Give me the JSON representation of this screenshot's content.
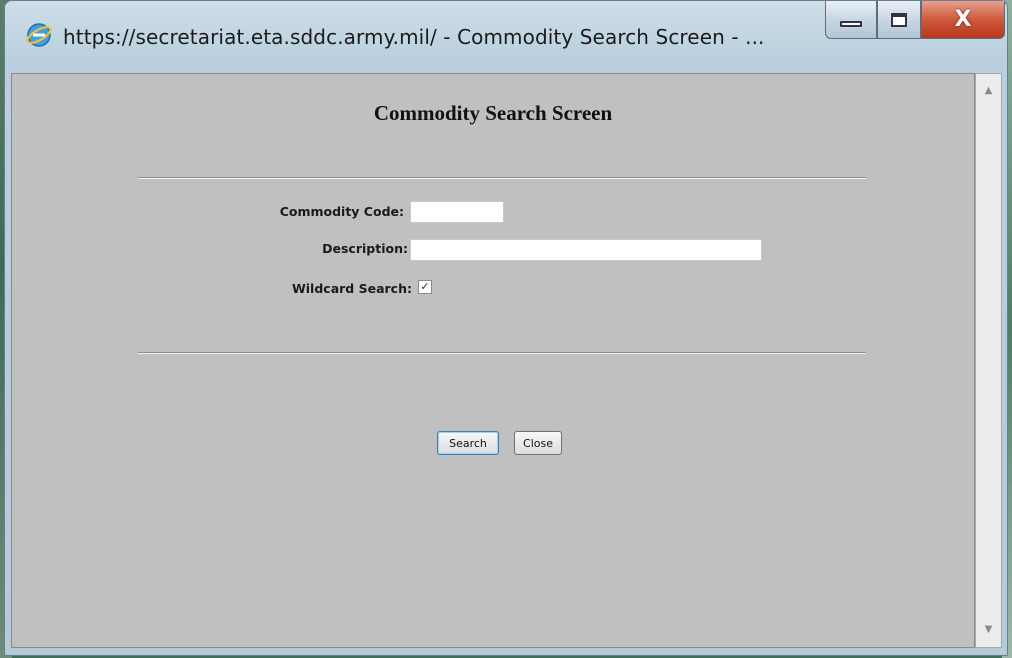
{
  "window": {
    "title": "https://secretariat.eta.sddc.army.mil/ - Commodity Search Screen - ...",
    "icon": "internet-explorer-icon",
    "controls": {
      "minimize": "minimize-icon",
      "maximize": "maximize-icon",
      "close": "X"
    }
  },
  "page": {
    "title": "Commodity Search Screen"
  },
  "form": {
    "commodity_code_label": "Commodity Code:",
    "commodity_code_value": "",
    "description_label": "Description:",
    "description_value": "",
    "wildcard_label": "Wildcard Search:",
    "wildcard_checked": true,
    "wildcard_mark": "✓"
  },
  "buttons": {
    "search": "Search",
    "close": "Close"
  },
  "scrollbar": {
    "up": "▲",
    "down": "▼"
  },
  "colors": {
    "page_background": "#c0c0c0",
    "window_frame": "#b9cfdd",
    "close_button": "#cf5a3c",
    "focused_button_border": "#3c7fb1"
  }
}
